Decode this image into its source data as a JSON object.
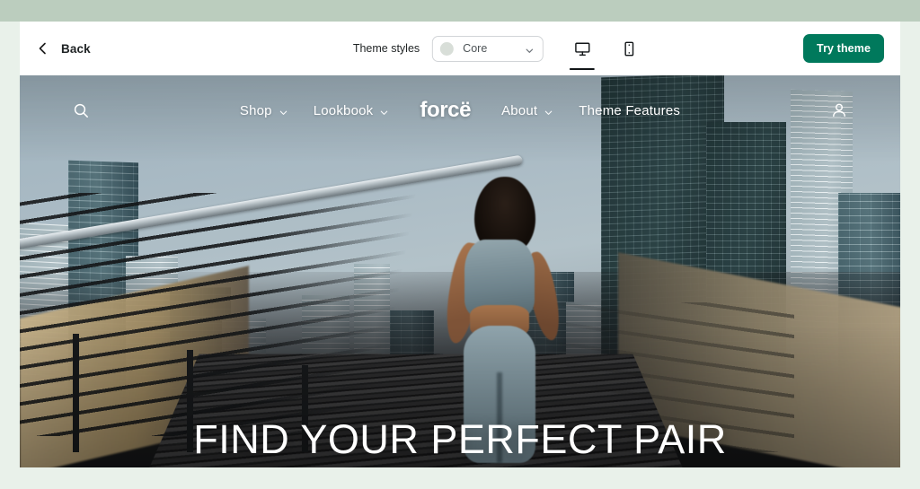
{
  "theme_preview": {
    "toolbar": {
      "back_label": "Back",
      "back_icon": "chevron-left-icon",
      "theme_styles_label": "Theme styles",
      "style_select": {
        "value": "Core",
        "swatch_color": "#d8ded8",
        "caret_icon": "chevron-down-icon"
      },
      "device_toggles": [
        {
          "name": "desktop",
          "icon": "desktop-icon",
          "active": true
        },
        {
          "name": "mobile",
          "icon": "mobile-icon",
          "active": false
        }
      ],
      "try_theme_label": "Try theme",
      "try_theme_color": "#00795c"
    },
    "storefront": {
      "brand": "forcë",
      "search_icon": "search-icon",
      "account_icon": "account-icon",
      "nav_links": [
        {
          "label": "Shop",
          "has_caret": true
        },
        {
          "label": "Lookbook",
          "has_caret": true
        },
        {
          "label": "About",
          "has_caret": true
        },
        {
          "label": "Theme Features",
          "has_caret": false
        }
      ],
      "hero_heading": "FIND YOUR PERFECT PAIR"
    }
  },
  "page": {
    "frame_color": "#bbcdbe",
    "gutter_color": "#e9f1ea"
  }
}
